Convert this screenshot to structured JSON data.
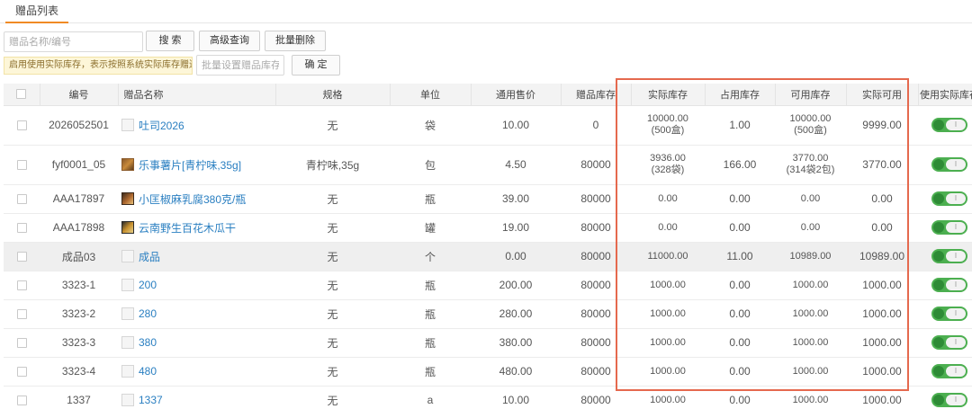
{
  "tabs": [
    {
      "label": "赠品列表",
      "active": true
    }
  ],
  "search": {
    "placeholder": "赠品名称/编号",
    "value": ""
  },
  "buttons": {
    "search": "搜 索",
    "advanced": "高级查询",
    "batch_delete": "批量删除",
    "confirm": "确 定"
  },
  "hint": "启用使用实际库存，表示按照系统实际库存赠送",
  "batch_stock": {
    "placeholder": "批量设置赠品库存",
    "value": ""
  },
  "columns": [
    "",
    "编号",
    "赠品名称",
    "规格",
    "单位",
    "通用售价",
    "赠品库存",
    "实际库存",
    "占用库存",
    "可用库存",
    "实际可用",
    "使用实际库存"
  ],
  "rows": [
    {
      "code": "2026052501",
      "name": "吐司2026",
      "thumb": "placeholder",
      "spec": "无",
      "unit": "袋",
      "price": "10.00",
      "gift_stock": "0",
      "actual": "10000.00",
      "actual_sub": "(500盒)",
      "occupied": "1.00",
      "available": "10000.00",
      "available_sub": "(500盒)",
      "actual_available": "9999.00",
      "use_actual": true,
      "highlight": false
    },
    {
      "code": "fyf0001_05",
      "name": "乐事薯片[青柠味,35g]",
      "thumb": "img1",
      "spec": "青柠味,35g",
      "unit": "包",
      "price": "4.50",
      "gift_stock": "80000",
      "actual": "3936.00",
      "actual_sub": "(328袋)",
      "occupied": "166.00",
      "available": "3770.00",
      "available_sub": "(314袋2包)",
      "actual_available": "3770.00",
      "use_actual": true,
      "highlight": false
    },
    {
      "code": "AAA17897",
      "name": "小匡椒麻乳腐380克/瓶",
      "thumb": "img2",
      "spec": "无",
      "unit": "瓶",
      "price": "39.00",
      "gift_stock": "80000",
      "actual": "0.00",
      "actual_sub": "",
      "occupied": "0.00",
      "available": "0.00",
      "available_sub": "",
      "actual_available": "0.00",
      "use_actual": true,
      "highlight": false
    },
    {
      "code": "AAA17898",
      "name": "云南野生百花木瓜干",
      "thumb": "img3",
      "spec": "无",
      "unit": "罐",
      "price": "19.00",
      "gift_stock": "80000",
      "actual": "0.00",
      "actual_sub": "",
      "occupied": "0.00",
      "available": "0.00",
      "available_sub": "",
      "actual_available": "0.00",
      "use_actual": true,
      "highlight": false
    },
    {
      "code": "成品03",
      "name": "成品",
      "thumb": "placeholder",
      "spec": "无",
      "unit": "个",
      "price": "0.00",
      "gift_stock": "80000",
      "actual": "11000.00",
      "actual_sub": "",
      "occupied": "11.00",
      "available": "10989.00",
      "available_sub": "",
      "actual_available": "10989.00",
      "use_actual": true,
      "highlight": true
    },
    {
      "code": "3323-1",
      "name": "200",
      "thumb": "placeholder",
      "spec": "无",
      "unit": "瓶",
      "price": "200.00",
      "gift_stock": "80000",
      "actual": "1000.00",
      "actual_sub": "",
      "occupied": "0.00",
      "available": "1000.00",
      "available_sub": "",
      "actual_available": "1000.00",
      "use_actual": true,
      "highlight": false
    },
    {
      "code": "3323-2",
      "name": "280",
      "thumb": "placeholder",
      "spec": "无",
      "unit": "瓶",
      "price": "280.00",
      "gift_stock": "80000",
      "actual": "1000.00",
      "actual_sub": "",
      "occupied": "0.00",
      "available": "1000.00",
      "available_sub": "",
      "actual_available": "1000.00",
      "use_actual": true,
      "highlight": false
    },
    {
      "code": "3323-3",
      "name": "380",
      "thumb": "placeholder",
      "spec": "无",
      "unit": "瓶",
      "price": "380.00",
      "gift_stock": "80000",
      "actual": "1000.00",
      "actual_sub": "",
      "occupied": "0.00",
      "available": "1000.00",
      "available_sub": "",
      "actual_available": "1000.00",
      "use_actual": true,
      "highlight": false
    },
    {
      "code": "3323-4",
      "name": "480",
      "thumb": "placeholder",
      "spec": "无",
      "unit": "瓶",
      "price": "480.00",
      "gift_stock": "80000",
      "actual": "1000.00",
      "actual_sub": "",
      "occupied": "0.00",
      "available": "1000.00",
      "available_sub": "",
      "actual_available": "1000.00",
      "use_actual": true,
      "highlight": false
    },
    {
      "code": "1337",
      "name": "1337",
      "thumb": "placeholder",
      "spec": "无",
      "unit": "a",
      "price": "10.00",
      "gift_stock": "80000",
      "actual": "1000.00",
      "actual_sub": "",
      "occupied": "0.00",
      "available": "1000.00",
      "available_sub": "",
      "actual_available": "1000.00",
      "use_actual": true,
      "highlight": false
    }
  ],
  "toggle_off_label": "I",
  "colors": {
    "accent_orange": "#e3762c",
    "link_blue": "#2a7fc1",
    "toggle_green": "#4caf50",
    "annotation_red": "#e5694e",
    "tab_underline": "#f08a24"
  }
}
